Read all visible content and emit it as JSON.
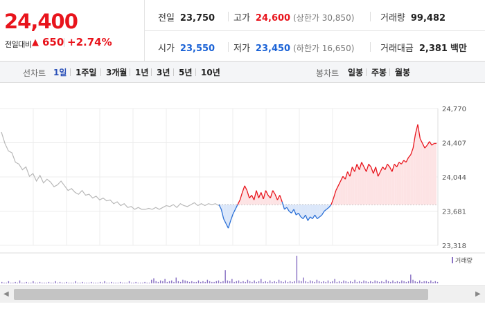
{
  "quote": {
    "price": "24,400",
    "change_label": "전일대비",
    "change_arrow": "▲",
    "change_value": "650",
    "change_pct": "+2.74%"
  },
  "stats": {
    "prev_close": {
      "label": "전일",
      "value": "23,750"
    },
    "high": {
      "label": "고가",
      "value": "24,600",
      "extra_label": "(상한가 30,850)"
    },
    "volume": {
      "label": "거래량",
      "value": "99,482"
    },
    "open": {
      "label": "시가",
      "value": "23,550"
    },
    "low": {
      "label": "저가",
      "value": "23,450",
      "extra_label": "(하한가 16,650)"
    },
    "trade_amount": {
      "label": "거래대금",
      "value": "2,381",
      "unit": "백만"
    }
  },
  "toolbar": {
    "line_chart_label": "선차트",
    "line_periods": [
      "1일",
      "1주일",
      "3개월",
      "1년",
      "3년",
      "5년",
      "10년"
    ],
    "active_period": "1일",
    "candle_chart_label": "봉차트",
    "candle_periods": [
      "일봉",
      "주봉",
      "월봉"
    ]
  },
  "chart_data": {
    "type": "line",
    "y_ticks": [
      "24,770",
      "24,407",
      "24,044",
      "23,681",
      "23,318"
    ],
    "ylim": [
      23318,
      24770
    ],
    "baseline": 23750,
    "volume_legend": "거래량",
    "grid": true,
    "colors": {
      "up": "#e8141c",
      "down": "#2a6fd6",
      "premarket": "#b8b8b8",
      "up_fill": "#fde3e4",
      "down_fill": "#dbe7fa",
      "volume": "#8a72c4"
    },
    "premarket_values": [
      24520,
      24400,
      24320,
      24300,
      24200,
      24180,
      24120,
      24150,
      24050,
      24080,
      24000,
      24060,
      23980,
      24020,
      23990,
      23940,
      23960,
      24000,
      23950,
      23900,
      23920,
      23880,
      23860,
      23900,
      23850,
      23860,
      23820,
      23840,
      23800,
      23820,
      23790,
      23800,
      23760,
      23780,
      23740,
      23760,
      23720,
      23730,
      23700,
      23720,
      23700,
      23700,
      23710,
      23700,
      23720,
      23700,
      23720,
      23740,
      23730,
      23750,
      23720,
      23760,
      23740,
      23730,
      23750,
      23770,
      23740,
      23760,
      23740,
      23760,
      23750,
      23760,
      23740
    ],
    "session_values": [
      23750,
      23700,
      23600,
      23550,
      23500,
      23580,
      23650,
      23700,
      23750,
      23800,
      23880,
      23950,
      23900,
      23820,
      23850,
      23800,
      23900,
      23820,
      23880,
      23810,
      23900,
      23850,
      23820,
      23900,
      23860,
      23800,
      23850,
      23780,
      23700,
      23720,
      23680,
      23660,
      23700,
      23640,
      23660,
      23620,
      23600,
      23640,
      23580,
      23620,
      23600,
      23640,
      23600,
      23620,
      23640,
      23680,
      23700,
      23720,
      23750,
      23820,
      23900,
      23950,
      24000,
      24050,
      24020,
      24100,
      24050,
      24150,
      24100,
      24180,
      24120,
      24200,
      24150,
      24100,
      24180,
      24150,
      24080,
      24150,
      24050,
      24100,
      24150,
      24120,
      24180,
      24150,
      24100,
      24180,
      24150,
      24200,
      24180,
      24220,
      24200,
      24250,
      24280,
      24350,
      24500,
      24600,
      24450,
      24400,
      24350,
      24380,
      24420,
      24380,
      24400,
      24400
    ],
    "volume": [
      2,
      1,
      1,
      3,
      1,
      1,
      2,
      1,
      4,
      1,
      1,
      2,
      1,
      1,
      3,
      1,
      1,
      2,
      1,
      1,
      1,
      2,
      1,
      1,
      3,
      1,
      2,
      1,
      1,
      2,
      1,
      1,
      1,
      3,
      1,
      1,
      2,
      1,
      1,
      1,
      2,
      1,
      1,
      1,
      2,
      1,
      3,
      1,
      1,
      2,
      1,
      1,
      1,
      2,
      1,
      1,
      1,
      3,
      1,
      1,
      2,
      1,
      1,
      1,
      2,
      1,
      1,
      5,
      7,
      3,
      2,
      4,
      3,
      6,
      2,
      3,
      4,
      2,
      8,
      3,
      2,
      5,
      4,
      3,
      2,
      3,
      2,
      2,
      4,
      2,
      3,
      2,
      5,
      3,
      2,
      2,
      3,
      4,
      2,
      3,
      18,
      4,
      3,
      6,
      2,
      3,
      4,
      2,
      3,
      2,
      5,
      3,
      2,
      4,
      2,
      3,
      6,
      2,
      3,
      2,
      4,
      2,
      3,
      2,
      5,
      3,
      2,
      4,
      2,
      3,
      2,
      3,
      38,
      4,
      3,
      8,
      3,
      2,
      4,
      3,
      2,
      5,
      3,
      2,
      3,
      2,
      4,
      2,
      3,
      6,
      2,
      3,
      2,
      4,
      3,
      2,
      3,
      2,
      5,
      2,
      3,
      2,
      4,
      3,
      2,
      3,
      2,
      4,
      3,
      2,
      3,
      2,
      5,
      3,
      2,
      4,
      2,
      3,
      2,
      4,
      3,
      2,
      3,
      12,
      5,
      3,
      2,
      4,
      2,
      3,
      3,
      2,
      4,
      2,
      3,
      2
    ]
  }
}
